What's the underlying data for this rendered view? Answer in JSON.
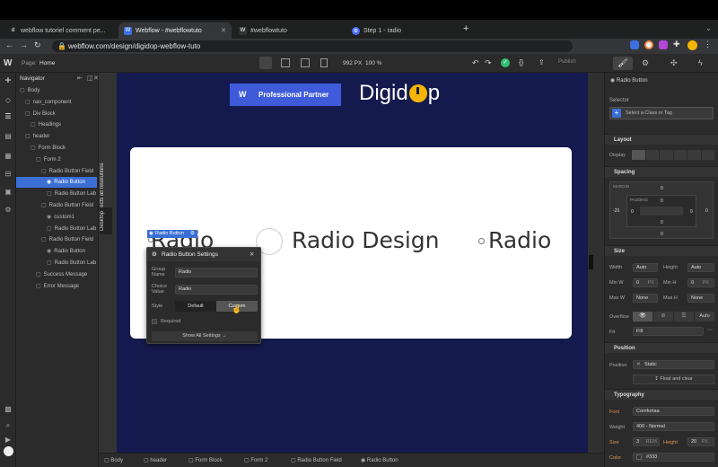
{
  "browser": {
    "tabs": [
      {
        "label": "webflow tutoriel comment pe...",
        "icon": "dailymotion-icon"
      },
      {
        "label": "Webflow - #webflowtuto",
        "icon": "webflow-icon",
        "active": true
      },
      {
        "label": "#webflowtuto",
        "icon": "webflow-icon"
      },
      {
        "label": "Step 1 - radio",
        "icon": "webflow-icon"
      }
    ],
    "new_tab": "+",
    "url": "webflow.com/design/digidop-webflow-tuto"
  },
  "designer": {
    "page_label": "Page:",
    "page_name": "Home",
    "width_value": "992",
    "width_unit": "PX",
    "zoom": "100 %",
    "publish_label": "Publish"
  },
  "navigator": {
    "title": "Navigator",
    "items": [
      {
        "label": "Body",
        "depth": 0
      },
      {
        "label": "nav_component",
        "depth": 1
      },
      {
        "label": "Div Block",
        "depth": 1
      },
      {
        "label": "Headings",
        "depth": 2
      },
      {
        "label": "header",
        "depth": 1
      },
      {
        "label": "Form Block",
        "depth": 2
      },
      {
        "label": "Form 2",
        "depth": 3
      },
      {
        "label": "Radio Button Field",
        "depth": 4
      },
      {
        "label": "Radio Button",
        "depth": 5,
        "selected": true
      },
      {
        "label": "Radio Button Lab",
        "depth": 5
      },
      {
        "label": "Radio Button Field",
        "depth": 4
      },
      {
        "label": "custom1",
        "depth": 5
      },
      {
        "label": "Radio Button Lab",
        "depth": 5
      },
      {
        "label": "Radio Button Field",
        "depth": 4
      },
      {
        "label": "Radio Button",
        "depth": 5
      },
      {
        "label": "Radio Button Lab",
        "depth": 5
      },
      {
        "label": "Success Message",
        "depth": 3
      },
      {
        "label": "Error Message",
        "depth": 3
      }
    ]
  },
  "sidetabs": {
    "affects": "Affects all resolutions",
    "desktop": "Desktop"
  },
  "canvas": {
    "partner_badge": "Professional Partner",
    "brand_left": "Digid",
    "brand_right": "p",
    "radios": [
      "Radio",
      "Radio Design",
      "Radio"
    ],
    "selection_tag": "Radio Button"
  },
  "settings_popup": {
    "title": "Radio Button Settings",
    "group_name_label": "Group Name",
    "group_name_value": "Radio",
    "choice_value_label": "Choice Value",
    "choice_value_value": "Radio",
    "style_label": "Style",
    "style_options": [
      "Default",
      "Custom"
    ],
    "required_label": "Required",
    "show_all": "Show All Settings"
  },
  "style_panel": {
    "element_name": "Radio Button",
    "selector_label": "Selector",
    "selector_placeholder": "Select a Class or Tag",
    "layout_title": "Layout",
    "display_label": "Display",
    "spacing_title": "Spacing",
    "margin_label": "MARGIN",
    "padding_label": "PADDING",
    "margin_top": "0",
    "margin_left": "-20",
    "margin_right": "0",
    "margin_bottom": "0",
    "padding_top": "0",
    "padding_left": "0",
    "padding_right": "0",
    "padding_bottom": "0",
    "size_title": "Size",
    "width_label": "Width",
    "width_value": "Auto",
    "height_label": "Height",
    "height_value": "Auto",
    "minw_label": "Min W",
    "minw_value": "0",
    "minh_label": "Min H",
    "minh_value": "0",
    "min_unit": "PX",
    "maxw_label": "Max W",
    "maxw_value": "None",
    "maxh_label": "Max H",
    "maxh_value": "None",
    "overflow_label": "Overflow",
    "overflow_auto": "Auto",
    "fit_label": "Fit",
    "fit_value": "Fill",
    "position_title": "Position",
    "position_label": "Position",
    "position_value": "Static",
    "float_label": "Float and clear",
    "typography_title": "Typography",
    "font_label": "Font",
    "font_value": "Comfortaa",
    "weight_label": "Weight",
    "weight_value": "400 - Normal",
    "size_label": "Size",
    "size_value": "3",
    "size_unit": "REM",
    "height_lbl": "Height",
    "lineheight_value": "20",
    "lineheight_unit": "PX",
    "color_label": "Color",
    "color_value": "#333"
  },
  "breadcrumbs": [
    "Body",
    "header",
    "Form Block",
    "Form 2",
    "Radio Button Field",
    "Radio Button"
  ],
  "colors": {
    "canvas_bg": "#141a4d",
    "accent": "#3c6fd6",
    "brand_yellow": "#f5b500"
  }
}
